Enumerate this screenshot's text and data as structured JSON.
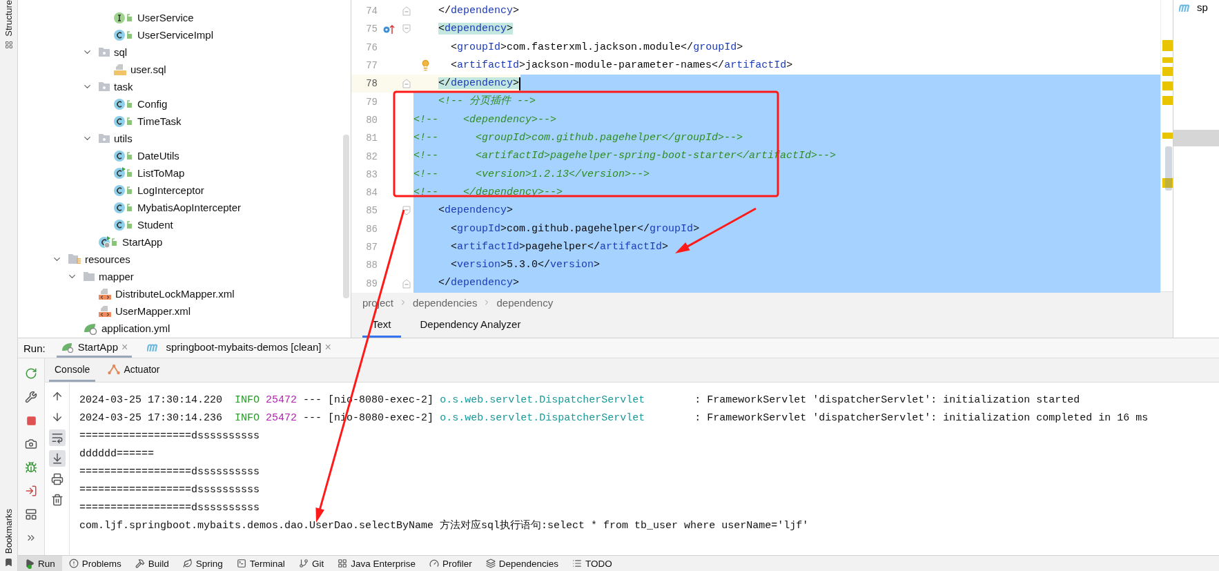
{
  "side_strip": {
    "top_label": "Structure",
    "bottom_label": "Bookmarks"
  },
  "project_tree": {
    "items": [
      {
        "children": [
          {
            "children": [
              {
                "children": [
                  {
                    "label": "UserService",
                    "kind": "interface"
                  },
                  {
                    "label": "UserServiceImpl",
                    "kind": "class"
                  }
                ]
              },
              {
                "label": "sql",
                "kind": "folder",
                "expanded": true,
                "children": [
                  {
                    "label": "user.sql",
                    "kind": "sql"
                  }
                ]
              },
              {
                "label": "task",
                "kind": "folder",
                "expanded": true,
                "children": [
                  {
                    "label": "Config",
                    "kind": "class"
                  },
                  {
                    "label": "TimeTask",
                    "kind": "class"
                  }
                ]
              },
              {
                "label": "utils",
                "kind": "folder",
                "expanded": true,
                "children": [
                  {
                    "label": "DateUtils",
                    "kind": "class"
                  },
                  {
                    "label": "ListToMap",
                    "kind": "runnable"
                  },
                  {
                    "label": "LogInterceptor",
                    "kind": "class"
                  },
                  {
                    "label": "MybatisAopIntercepter",
                    "kind": "class"
                  },
                  {
                    "label": "Student",
                    "kind": "class"
                  }
                ]
              },
              {
                "label": "StartApp",
                "kind": "app"
              }
            ]
          }
        ]
      },
      {
        "label": "resources",
        "kind": "resources",
        "expanded": true,
        "children": [
          {
            "label": "mapper",
            "kind": "directory",
            "expanded": true,
            "children": [
              {
                "label": "DistributeLockMapper.xml",
                "kind": "xml"
              },
              {
                "label": "UserMapper.xml",
                "kind": "xml"
              }
            ]
          },
          {
            "label": "application.yml",
            "kind": "yml"
          }
        ]
      }
    ]
  },
  "editor": {
    "lines": [
      {
        "number": "74",
        "text": "    </dependency>",
        "kind": "code",
        "fold_close": true,
        "selected": false
      },
      {
        "number": "75",
        "text": "    <dependency>",
        "kind": "code",
        "fold_open": true,
        "override": true,
        "matched": true,
        "selected": false
      },
      {
        "number": "76",
        "text": "      <groupId>com.fasterxml.jackson.module</groupId>",
        "kind": "code",
        "selected": false
      },
      {
        "number": "77",
        "text": "      <artifactId>jackson-module-parameter-names</artifactId>",
        "kind": "code",
        "bulb": true,
        "selected": false
      },
      {
        "number": "78",
        "text": "    </dependency>",
        "kind": "code",
        "fold_close": true,
        "matched": true,
        "current": true,
        "selected": true
      },
      {
        "number": "79",
        "text": "    <!-- 分页插件 -->",
        "kind": "comment",
        "selected": true
      },
      {
        "number": "80",
        "text": "<!--    <dependency>-->",
        "kind": "comment",
        "selected": true
      },
      {
        "number": "81",
        "text": "<!--      <groupId>com.github.pagehelper</groupId>-->",
        "kind": "comment",
        "selected": true
      },
      {
        "number": "82",
        "text": "<!--      <artifactId>pagehelper-spring-boot-starter</artifactId>-->",
        "kind": "comment",
        "selected": true
      },
      {
        "number": "83",
        "text": "<!--      <version>1.2.13</version>-->",
        "kind": "comment",
        "selected": true
      },
      {
        "number": "84",
        "text": "<!--    </dependency>-->",
        "kind": "comment",
        "selected": true
      },
      {
        "number": "85",
        "text": "    <dependency>",
        "kind": "code",
        "fold_open": true,
        "selected": true
      },
      {
        "number": "86",
        "text": "      <groupId>com.github.pagehelper</groupId>",
        "kind": "code",
        "selected": true
      },
      {
        "number": "87",
        "text": "      <artifactId>pagehelper</artifactId>",
        "kind": "code",
        "selected": true
      },
      {
        "number": "88",
        "text": "      <version>5.3.0</version>",
        "kind": "code",
        "selected": true
      },
      {
        "number": "89",
        "text": "    </dependency>",
        "kind": "code",
        "fold_close": true,
        "selected": true
      }
    ],
    "breadcrumbs": [
      "project",
      "dependencies",
      "dependency"
    ],
    "tabs": [
      {
        "label": "Text",
        "selected": true
      },
      {
        "label": "Dependency Analyzer",
        "selected": false
      }
    ]
  },
  "right_panel": {
    "title": "sp"
  },
  "run_panel": {
    "label": "Run:",
    "tabs": [
      {
        "label": "StartApp",
        "kind": "spring",
        "close": "×",
        "selected": true
      },
      {
        "label": "springboot-mybaits-demos [clean]",
        "kind": "maven",
        "close": "×",
        "selected": false
      }
    ],
    "toolbar": [
      {
        "kind": "rerun"
      },
      {
        "kind": "wrench"
      },
      {
        "kind": "stop"
      },
      {
        "kind": "camera"
      },
      {
        "kind": "debug"
      },
      {
        "kind": "exit"
      },
      {
        "kind": "layout"
      },
      {
        "kind": "more"
      }
    ],
    "console_tabs": [
      {
        "label": "Console",
        "kind": "plain",
        "selected": true
      },
      {
        "label": "Actuator",
        "kind": "actuator",
        "selected": false
      }
    ],
    "console_toolbar": [
      {
        "kind": "up",
        "on": false
      },
      {
        "kind": "down",
        "on": false
      },
      {
        "kind": "wrap",
        "on": true
      },
      {
        "kind": "scroll",
        "on": true
      },
      {
        "kind": "print",
        "on": false
      },
      {
        "kind": "trash",
        "on": false
      }
    ],
    "lines": [
      {
        "segments": [
          {
            "kind": "text",
            "text": "2024-03-25 17:30:14.220  "
          },
          {
            "kind": "level",
            "text": "INFO"
          },
          {
            "kind": "pid",
            "text": " 25472"
          },
          {
            "kind": "text",
            "text": " --- [nio-8080-exec-2] "
          },
          {
            "kind": "logger",
            "text": "o.s.web.servlet.DispatcherServlet"
          },
          {
            "kind": "text",
            "text": "        : FrameworkServlet 'dispatcherServlet': initialization started"
          }
        ]
      },
      {
        "segments": [
          {
            "kind": "text",
            "text": "2024-03-25 17:30:14.236  "
          },
          {
            "kind": "level",
            "text": "INFO"
          },
          {
            "kind": "pid",
            "text": " 25472"
          },
          {
            "kind": "text",
            "text": " --- [nio-8080-exec-2] "
          },
          {
            "kind": "logger",
            "text": "o.s.web.servlet.DispatcherServlet"
          },
          {
            "kind": "text",
            "text": "        : FrameworkServlet 'dispatcherServlet': initialization completed in 16 ms"
          }
        ]
      },
      {
        "segments": [
          {
            "kind": "text",
            "text": "==================dssssssssss"
          }
        ]
      },
      {
        "segments": [
          {
            "kind": "text",
            "text": "dddddd======"
          }
        ]
      },
      {
        "segments": [
          {
            "kind": "text",
            "text": "==================dssssssssss"
          }
        ]
      },
      {
        "segments": [
          {
            "kind": "text",
            "text": "==================dssssssssss"
          }
        ]
      },
      {
        "segments": [
          {
            "kind": "text",
            "text": "==================dssssssssss"
          }
        ]
      },
      {
        "segments": [
          {
            "kind": "text",
            "text": "com.ljf.springboot.mybaits.demos.dao.UserDao.selectByName 方法对应sql执行语句:select * from tb_user where userName='ljf'"
          }
        ]
      }
    ]
  },
  "tool_window_bar": [
    {
      "label": "Run",
      "kind": "run",
      "selected": true
    },
    {
      "label": "Problems",
      "kind": "problems",
      "selected": false
    },
    {
      "label": "Build",
      "kind": "build",
      "selected": false
    },
    {
      "label": "Spring",
      "kind": "spring",
      "selected": false
    },
    {
      "label": "Terminal",
      "kind": "terminal",
      "selected": false
    },
    {
      "label": "Git",
      "kind": "git",
      "selected": false
    },
    {
      "label": "Java Enterprise",
      "kind": "enterprise",
      "selected": false
    },
    {
      "label": "Profiler",
      "kind": "profiler",
      "selected": false
    },
    {
      "label": "Dependencies",
      "kind": "dependencies",
      "selected": false
    },
    {
      "label": "TODO",
      "kind": "todo",
      "selected": false
    }
  ],
  "annotations": [
    {
      "kind": "box"
    },
    {
      "kind": "arrow"
    },
    {
      "kind": "arrow"
    }
  ]
}
